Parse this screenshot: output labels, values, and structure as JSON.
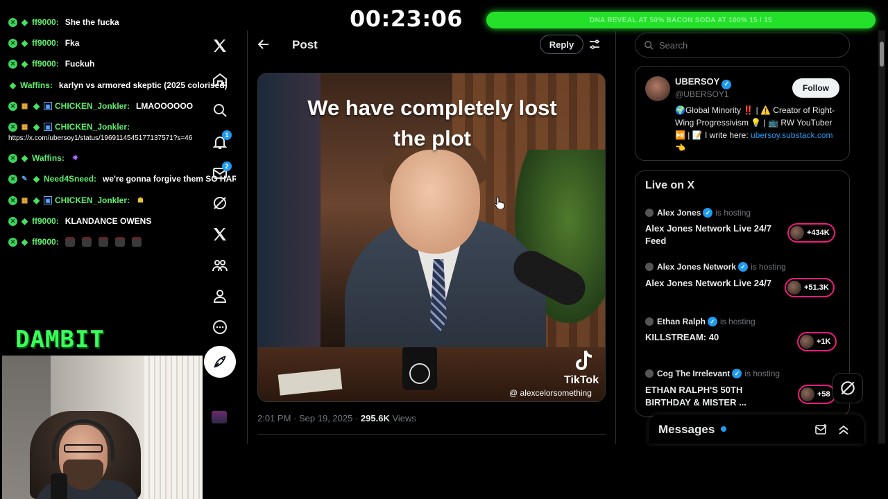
{
  "timer": "00:23:06",
  "banner": "DNA REVEAL AT 50% BACON SODA AT 100% 15 / 15",
  "brand": "DAMBIT",
  "chat": {
    "lines": [
      {
        "user": "ff9000:",
        "text": "She the fucka"
      },
      {
        "user": "ff9000:",
        "text": "Fka"
      },
      {
        "user": "ff9000:",
        "text": "Fuckuh"
      },
      {
        "user": "Waffins:",
        "text": "karlyn vs armored skeptic (2025 colorised)"
      },
      {
        "user": "CHICKEN_Jonkler:",
        "text": "LMAOOOOOO"
      },
      {
        "user": "CHICKEN_Jonkler:",
        "text": ""
      },
      {
        "user": "Waffins:",
        "text": ""
      },
      {
        "user": "Need4Sneed:",
        "text": "we're gonna forgive them SO HARD"
      },
      {
        "user": "CHICKEN_Jonkler:",
        "text": ""
      },
      {
        "user": "ff9000:",
        "text": "KLANDANCE OWENS"
      },
      {
        "user": "ff9000:",
        "text": ""
      }
    ],
    "url": "https://x.com/ubersoy1/status/1969114545177137571?s=46"
  },
  "nav": {
    "badges": {
      "notifications": "1",
      "messages": "2"
    }
  },
  "post": {
    "header_title": "Post",
    "reply_label": "Reply",
    "video_caption_line1": "We have completely lost",
    "video_caption_line2": "the plot",
    "tiktok_name": "TikTok",
    "tiktok_handle": "@ alexcelorsomething",
    "time": "2:01 PM",
    "date": "Sep 19, 2025",
    "views": "295.6K",
    "views_label": "Views"
  },
  "search": {
    "placeholder": "Search"
  },
  "profile": {
    "name": "UBERSOY",
    "handle": "@UBERSOY1",
    "follow_label": "Follow",
    "bio": "🌍Global Minority ‼️ | ⚠️ Creator of Right-Wing Progressivism 💡 | 📺 RW YouTuber ⏯️ | 📝 I write here:",
    "link": "ubersoy.substack.com 👈"
  },
  "live": {
    "title": "Live on X",
    "hosting_label": "is hosting",
    "items": [
      {
        "host": "Alex Jones",
        "title": "Alex Jones Network Live 24/7 Feed",
        "count": "+434K"
      },
      {
        "host": "Alex Jones Network",
        "title": "Alex Jones Network Live 24/7",
        "count": "+51.3K"
      },
      {
        "host": "Ethan Ralph",
        "title": "KILLSTREAM: 40",
        "count": "+1K"
      },
      {
        "host": "Cog The Irrelevant",
        "title": "ETHAN RALPH'S 50TH BIRTHDAY & MISTER ...",
        "count": "+58"
      }
    ]
  },
  "messages": {
    "title": "Messages"
  },
  "colors": {
    "accent": "#1d9bf0",
    "live": "#f91880",
    "chat_user": "#5ef06c",
    "banner": "#25e02b"
  }
}
